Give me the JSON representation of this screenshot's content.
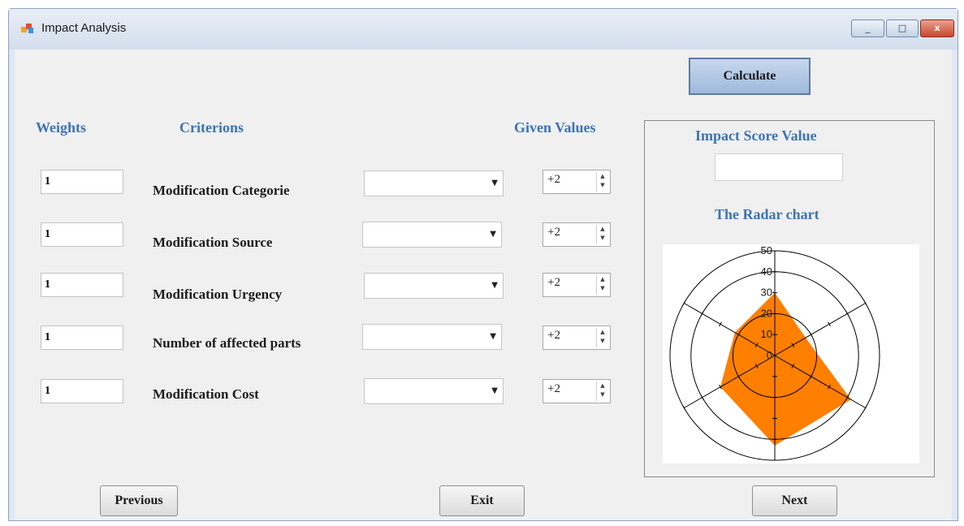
{
  "window": {
    "title": "Impact Analysis",
    "minimize_symbol": "_",
    "maximize_symbol": "□",
    "close_symbol": "x"
  },
  "buttons": {
    "calculate": "Calculate",
    "previous": "Previous",
    "exit": "Exit",
    "next": "Next"
  },
  "headers": {
    "weights": "Weights",
    "criterions": "Criterions",
    "given_values": "Given Values"
  },
  "criteria": [
    {
      "weight": "1",
      "label": "Modification Categorie",
      "given_value": "+2"
    },
    {
      "weight": "1",
      "label": "Modification Source",
      "given_value": "+2"
    },
    {
      "weight": "1",
      "label": "Modification Urgency",
      "given_value": "+2"
    },
    {
      "weight": "1",
      "label": "Number of affected parts",
      "given_value": "+2"
    },
    {
      "weight": "1",
      "label": "Modification Cost",
      "given_value": "+2"
    }
  ],
  "result_panel": {
    "score_label": "Impact Score Value",
    "score_value": "",
    "radar_label": "The Radar chart"
  },
  "chart_data": {
    "type": "radar",
    "axes_count": 6,
    "r_ticks": [
      0,
      10,
      20,
      30,
      40,
      50
    ],
    "r_max": 50,
    "series": [
      {
        "values": [
          30,
          17,
          42,
          43,
          30,
          22
        ]
      }
    ],
    "colors": {
      "fill": "#ff7f00",
      "grid": "#000000"
    }
  },
  "colors": {
    "heading_blue": "#3d73b3",
    "client_background": "#f0f0f0",
    "calculate_button": "#b4c8e4"
  }
}
